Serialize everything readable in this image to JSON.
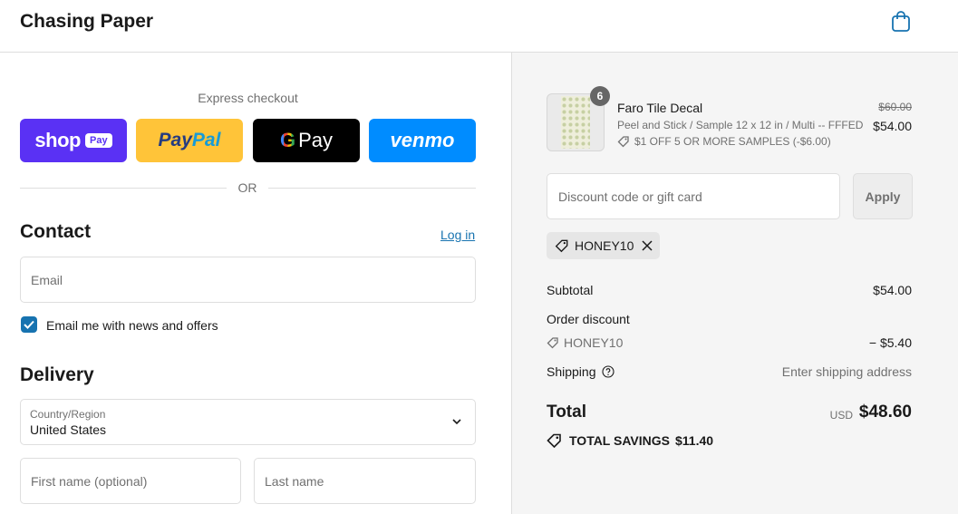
{
  "header": {
    "brand": "Chasing Paper",
    "cart_icon": "shopping-bag-icon"
  },
  "express": {
    "title": "Express checkout",
    "buttons": {
      "shop": "shop",
      "shop_pay": "Pay",
      "paypal_1": "Pay",
      "paypal_2": "Pal",
      "gpay_g": "G",
      "gpay_pay": "Pay",
      "venmo": "venmo"
    },
    "or": "OR"
  },
  "contact": {
    "title": "Contact",
    "login": "Log in",
    "email_placeholder": "Email",
    "newsletter_label": "Email me with news and offers",
    "newsletter_checked": true
  },
  "delivery": {
    "title": "Delivery",
    "country_label": "Country/Region",
    "country_value": "United States",
    "first_name_placeholder": "First name (optional)",
    "last_name_placeholder": "Last name"
  },
  "order": {
    "item": {
      "quantity": "6",
      "name": "Faro Tile Decal",
      "variant": "Peel and Stick / Sample 12 x 12 in / Multi -- FFFED",
      "discount": "$1 OFF 5 OR MORE SAMPLES (-$6.00)",
      "original_price": "$60.00",
      "price": "$54.00"
    },
    "discount_placeholder": "Discount code or gift card",
    "apply": "Apply",
    "applied_code": "HONEY10",
    "subtotal_label": "Subtotal",
    "subtotal_value": "$54.00",
    "order_discount_label": "Order discount",
    "order_discount_code": "HONEY10",
    "order_discount_value": "− $5.40",
    "shipping_label": "Shipping",
    "shipping_value": "Enter shipping address",
    "total_label": "Total",
    "total_currency": "USD",
    "total_value": "$48.60",
    "savings_label": "TOTAL SAVINGS",
    "savings_value": "$11.40"
  },
  "colors": {
    "accent": "#1773b0",
    "shop": "#5a31f4",
    "paypal": "#ffc439",
    "gpay": "#000000",
    "venmo": "#008cff"
  }
}
